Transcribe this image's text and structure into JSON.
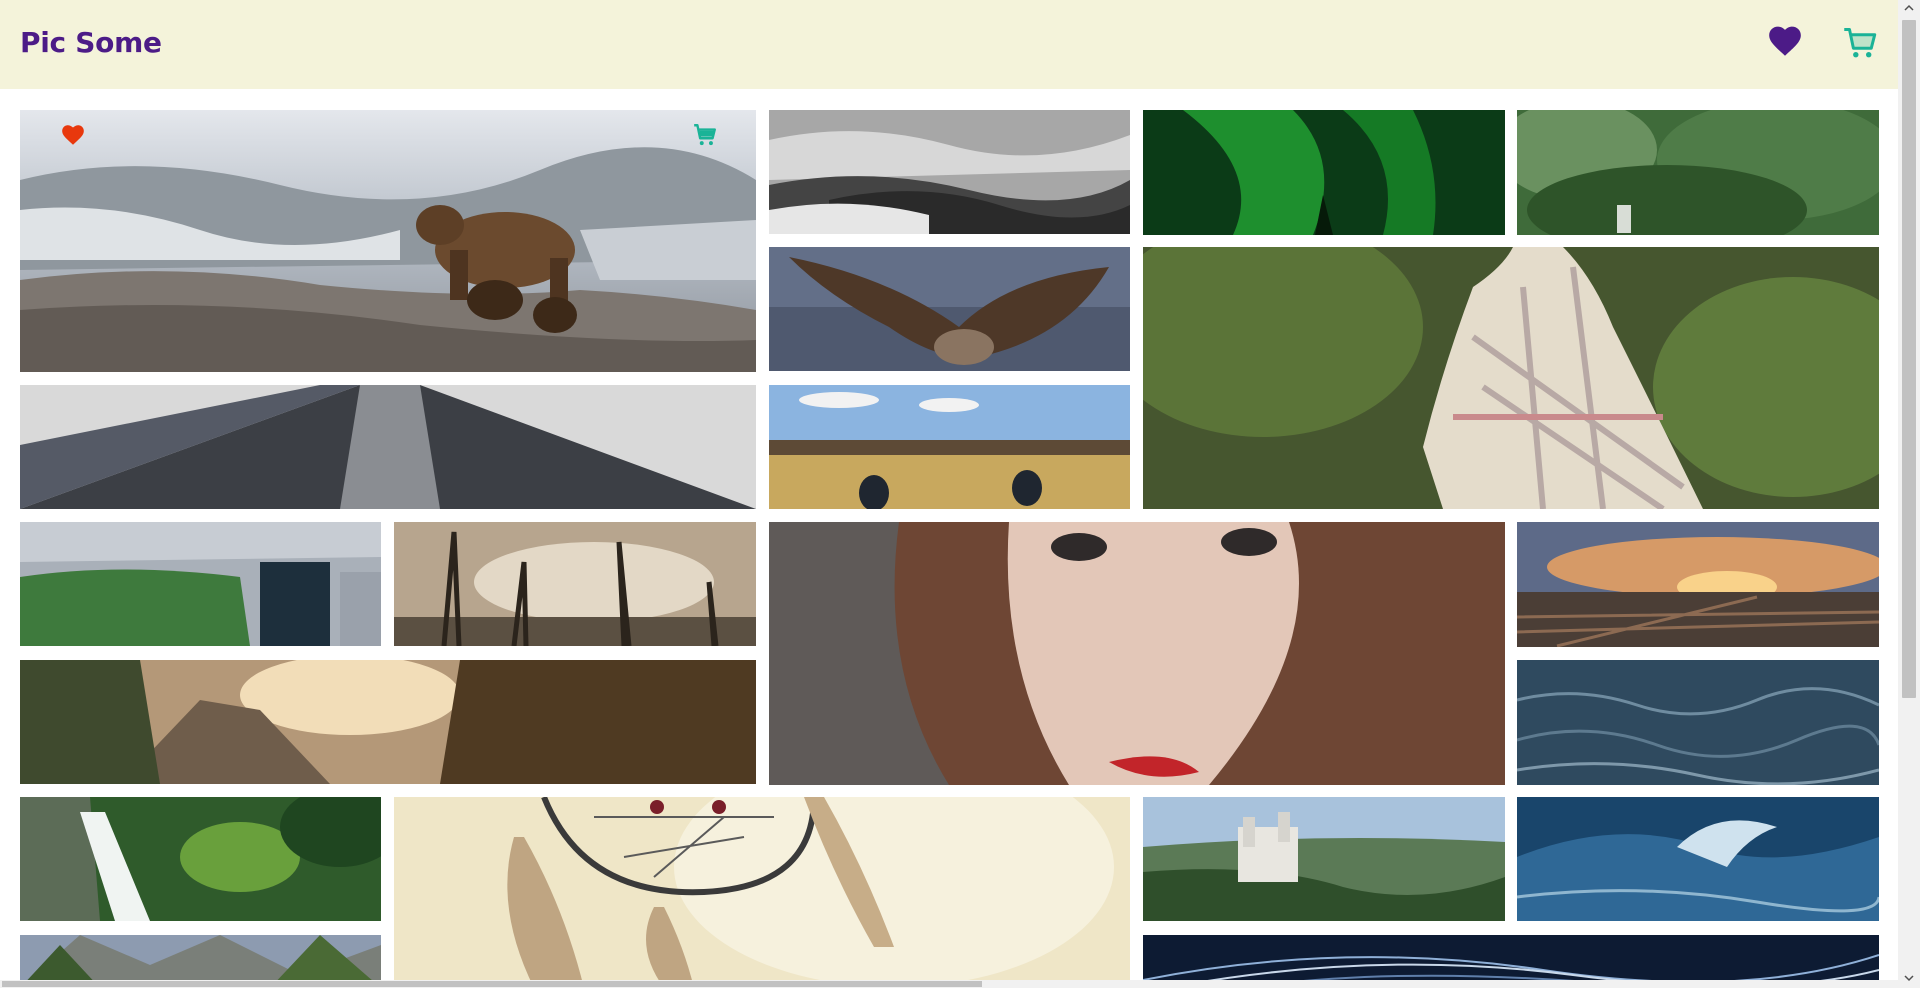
{
  "app": {
    "title": "Pic Some"
  },
  "header": {
    "favorites_icon": "heart-icon",
    "cart_icon": "cart-icon",
    "favorites_color": "#4c1b87",
    "cart_color": "#1ab397"
  },
  "colors": {
    "header_bg": "#f4f3da",
    "brand": "#4c1b87",
    "favorite_active": "#e8380d",
    "cart_accent": "#1ab397"
  },
  "photos": [
    {
      "subject": "bear-with-cubs",
      "favorited": true,
      "in_cart": true
    },
    {
      "subject": "foggy-forest"
    },
    {
      "subject": "northern-lights"
    },
    {
      "subject": "hiker-in-bushes"
    },
    {
      "subject": "vulture"
    },
    {
      "subject": "dog-in-blanket"
    },
    {
      "subject": "skyscraper"
    },
    {
      "subject": "sneakers-in-field"
    },
    {
      "subject": "city-park"
    },
    {
      "subject": "dead-trees"
    },
    {
      "subject": "woman-face"
    },
    {
      "subject": "train-yard-sunset"
    },
    {
      "subject": "mountain-sunset"
    },
    {
      "subject": "ocean-waves"
    },
    {
      "subject": "waterfall"
    },
    {
      "subject": "dreamcatcher"
    },
    {
      "subject": "castle"
    },
    {
      "subject": "blue-wave"
    },
    {
      "subject": "mountain-valley"
    },
    {
      "subject": "star-trails"
    }
  ]
}
